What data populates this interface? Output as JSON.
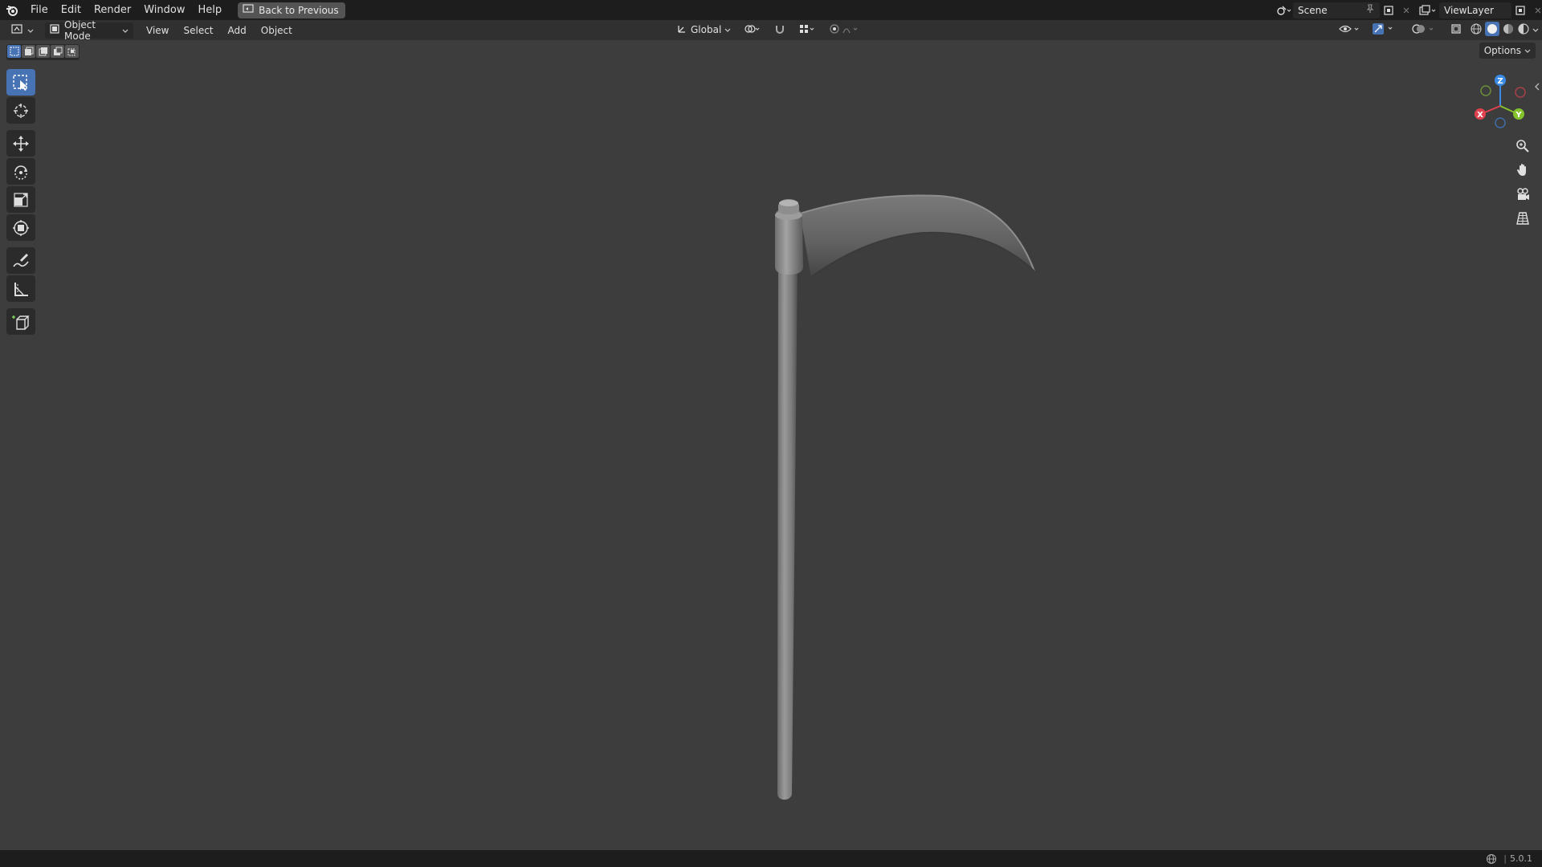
{
  "menu": {
    "items": [
      "File",
      "Edit",
      "Render",
      "Window",
      "Help"
    ],
    "back_label": "Back to Previous"
  },
  "scene": {
    "name": "Scene"
  },
  "view_layer": {
    "name": "ViewLayer"
  },
  "header": {
    "mode_label": "Object Mode",
    "menus": [
      "View",
      "Select",
      "Add",
      "Object"
    ],
    "orientation_label": "Global"
  },
  "viewport": {
    "options_label": "Options",
    "gizmo_axes": {
      "x": "X",
      "y": "Y",
      "z": "Z"
    },
    "object_name": "scythe"
  },
  "toolbar": {
    "tools": [
      "select-box",
      "cursor",
      "move",
      "rotate",
      "scale",
      "transform",
      "annotate",
      "measure",
      "add-cube"
    ],
    "active": "select-box"
  },
  "status": {
    "version": "5.0.1"
  },
  "colors": {
    "accent": "#4772b3",
    "x_axis": "#e0424f",
    "y_axis": "#84c32b",
    "z_axis": "#3a8ae6"
  }
}
